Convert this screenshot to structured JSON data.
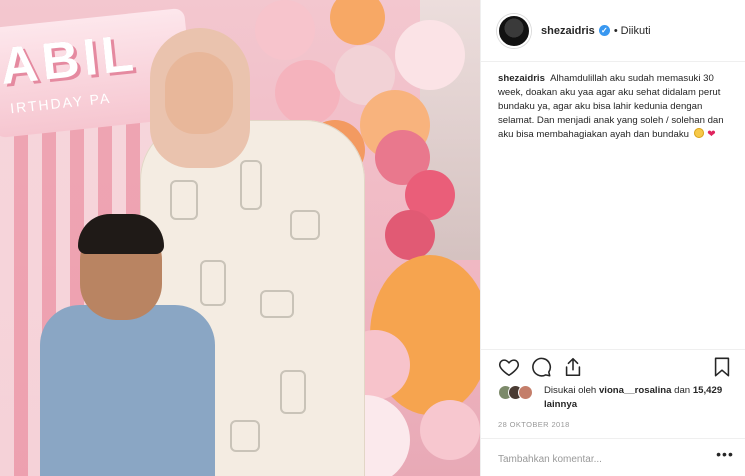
{
  "photo": {
    "banner_letters": "ABIL",
    "banner_sub": "IRTHDAY PA"
  },
  "header": {
    "username": "shezaidris",
    "verified_icon": "verified-badge-icon",
    "separator": "•",
    "follow_status": "Diikuti"
  },
  "caption": {
    "username": "shezaidris",
    "text": "Alhamdulillah aku sudah memasuki 30 week, doakan aku yaa agar aku sehat didalam perut bundaku ya, agar aku bisa lahir kedunia dengan selamat. Dan menjadi anak yang soleh / solehan dan aku bisa membahagiakan ayah dan bundaku"
  },
  "actions": {
    "like_icon": "heart-outline-icon",
    "comment_icon": "comment-bubble-icon",
    "share_icon": "share-upload-icon",
    "save_icon": "bookmark-icon"
  },
  "likes": {
    "prefix": "Disukai oleh",
    "user": "viona__rosalina",
    "conj": "dan",
    "count": "15,429 lainnya"
  },
  "date": "28 OKTOBER 2018",
  "comment": {
    "placeholder": "Tambahkan komentar...",
    "more": "•••"
  }
}
